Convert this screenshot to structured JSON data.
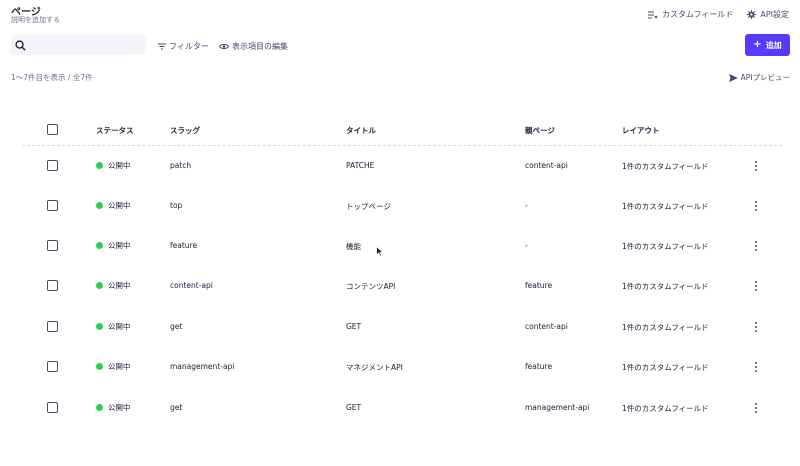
{
  "page": {
    "title": "ページ",
    "subtitle": "説明を追加する"
  },
  "top_actions": {
    "custom_field": "カスタムフィールド",
    "api_settings": "API設定"
  },
  "toolbar": {
    "search_placeholder": "",
    "filter": "フィルター",
    "edit_columns": "表示項目の編集",
    "add_button": "追加"
  },
  "list": {
    "count": "1〜7件目を表示 / 全7件",
    "api_preview": "APIプレビュー"
  },
  "columns": {
    "status": "ステータス",
    "slug": "スラッグ",
    "title": "タイトル",
    "parent": "親ページ",
    "layout": "レイアウト"
  },
  "rows": [
    {
      "status": "公開中",
      "slug": "patch",
      "title": "PATCHE",
      "parent": "content-api",
      "layout": "1件のカスタムフィールド"
    },
    {
      "status": "公開中",
      "slug": "top",
      "title": "トップページ",
      "parent": "-",
      "layout": "1件のカスタムフィールド"
    },
    {
      "status": "公開中",
      "slug": "feature",
      "title": "機能",
      "parent": "-",
      "layout": "1件のカスタムフィールド"
    },
    {
      "status": "公開中",
      "slug": "content-api",
      "title": "コンテンツAPI",
      "parent": "feature",
      "layout": "1件のカスタムフィールド"
    },
    {
      "status": "公開中",
      "slug": "get",
      "title": "GET",
      "parent": "content-api",
      "layout": "1件のカスタムフィールド"
    },
    {
      "status": "公開中",
      "slug": "management-api",
      "title": "マネジメントAPI",
      "parent": "feature",
      "layout": "1件のカスタムフィールド"
    },
    {
      "status": "公開中",
      "slug": "get",
      "title": "GET",
      "parent": "management-api",
      "layout": "1件のカスタムフィールド"
    }
  ],
  "colors": {
    "accent": "#563bff",
    "published": "#2fcd53",
    "text": "#21213b",
    "muted": "#6b6f91"
  },
  "icons": [
    "search-icon",
    "filter-icon",
    "eye-icon",
    "plus-icon",
    "custom-field-icon",
    "gear-icon",
    "send-icon",
    "kebab-menu-icon",
    "mouse-cursor-icon"
  ]
}
